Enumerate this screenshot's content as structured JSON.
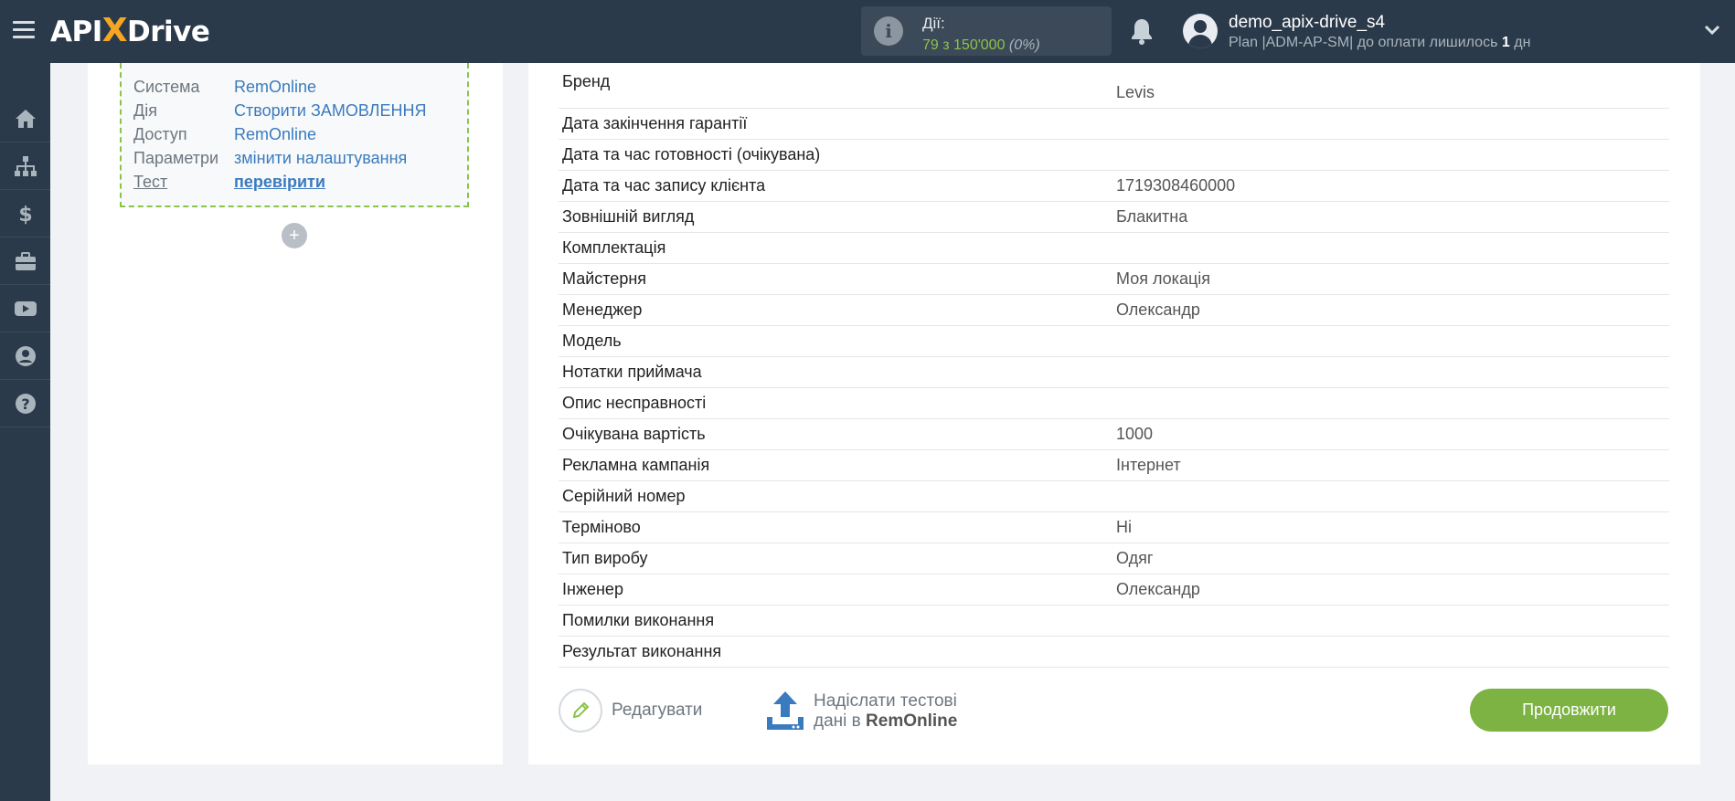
{
  "header": {
    "logo_prefix": "API",
    "logo_x": "X",
    "logo_suffix": "Drive",
    "actions_label": "Дії:",
    "actions_value": "79 з 150'000",
    "actions_percent": "(0%)",
    "user_name": "demo_apix-drive_s4",
    "plan_text": "Plan |ADM-AP-SM| до оплати лишилось",
    "plan_days_num": "1",
    "plan_days_unit": "дн"
  },
  "sidebar": {
    "items": [
      "home-icon",
      "sitemap-icon",
      "dollar-icon",
      "briefcase-icon",
      "youtube-icon",
      "user-icon",
      "help-icon"
    ]
  },
  "step": {
    "rows": [
      {
        "key": "Система",
        "value": "RemOnline"
      },
      {
        "key": "Дія",
        "value": "Створити ЗАМОВЛЕННЯ"
      },
      {
        "key": "Доступ",
        "value": "RemOnline"
      },
      {
        "key": "Параметри",
        "value": "змінити налаштування"
      },
      {
        "key": "Тест",
        "value": "перевірити"
      }
    ],
    "plus": "+"
  },
  "fields": [
    {
      "name": "Бренд",
      "value": "Levis"
    },
    {
      "name": "Дата закінчення гарантії",
      "value": ""
    },
    {
      "name": "Дата та час готовності (очікувана)",
      "value": ""
    },
    {
      "name": "Дата та час запису клієнта",
      "value": "1719308460000"
    },
    {
      "name": "Зовнішній вигляд",
      "value": "Блакитна"
    },
    {
      "name": "Комплектація",
      "value": ""
    },
    {
      "name": "Майстерня",
      "value": "Моя локація"
    },
    {
      "name": "Менеджер",
      "value": "Олександр"
    },
    {
      "name": "Модель",
      "value": ""
    },
    {
      "name": "Нотатки приймача",
      "value": ""
    },
    {
      "name": "Опис несправності",
      "value": ""
    },
    {
      "name": "Очікувана вартість",
      "value": "1000"
    },
    {
      "name": "Рекламна кампанія",
      "value": "Інтернет"
    },
    {
      "name": "Серійний номер",
      "value": ""
    },
    {
      "name": "Терміново",
      "value": "Ні"
    },
    {
      "name": "Тип виробу",
      "value": "Одяг"
    },
    {
      "name": "Інженер",
      "value": "Олександр"
    },
    {
      "name": "Помилки виконання",
      "value": ""
    },
    {
      "name": "Результат виконання",
      "value": ""
    }
  ],
  "buttons": {
    "edit": "Редагувати",
    "send_line1": "Надіслати тестові",
    "send_line2_prefix": "дані в",
    "send_line2_target": "RemOnline",
    "continue": "Продовжити"
  },
  "colors": {
    "topbar": "#2b3a4a",
    "accent_green": "#7cb342",
    "link_blue": "#3a7bbf",
    "logo_x": "#f5a623"
  }
}
